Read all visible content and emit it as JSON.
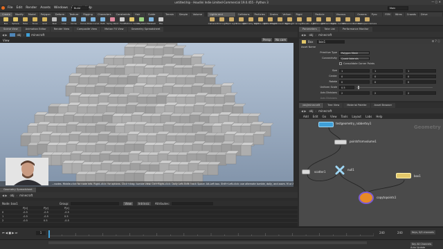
{
  "window": {
    "title": "untitled.hip - Houdini Indie Limited-Commercial 19.0.455 - Python 3"
  },
  "menubar": {
    "items": [
      "File",
      "Edit",
      "Render",
      "Assets",
      "Windows",
      "Arnold",
      "Help"
    ],
    "desktop": "Build",
    "user": "Main"
  },
  "shelf_tabs_left": [
    "Create",
    "Modify",
    "Model",
    "Polygon",
    "Deform",
    "Texture",
    "Rigging",
    "Characters",
    "Constraints",
    "Hair Utils",
    "Guide Process",
    "Terrain FX",
    "Simple FX",
    "Volume"
  ],
  "shelf_tabs_right": [
    "Lights and Cameras",
    "Collisions",
    "Particles",
    "Grains",
    "Vellum",
    "Rigid Bodies",
    "Particle Fluids",
    "Viscous Fluids",
    "Oceans",
    "Pyro FX",
    "FEM",
    "Wires",
    "Crowds",
    "Drive Simulation"
  ],
  "shelf_tools_left": [
    "Box",
    "Sphere",
    "Tube",
    "Torus",
    "Grid",
    "Null",
    "Line",
    "Circle",
    "Curve",
    "Draw Curve",
    "Path",
    "Spray Paint",
    "Font",
    "Platonic Solids",
    "L-System",
    "Metaball",
    "File"
  ],
  "shelf_tools_right": [
    "Camera",
    "Point Light",
    "Spot Light",
    "Area Light",
    "Geometry Light",
    "Volume Light",
    "Distant Light",
    "Environment Light",
    "Sky Light",
    "GI Light",
    "Caustic Light",
    "Portal Light",
    "Ambient Light",
    "Stereo Camera",
    "VR Camera",
    "Switcher",
    "Gamepad Camera"
  ],
  "left_pane_tabs": [
    "Scene View",
    "Animation Editor",
    "Render View",
    "Composite View",
    "Motion FX View",
    "Geometry Spreadsheet"
  ],
  "left_path": {
    "context": "obj",
    "node": "minecraft"
  },
  "view_header": {
    "label": "View",
    "persp": "Persp",
    "cam": "No cam"
  },
  "viewport_status": "...nodes. Middle-click for node info. Right-click: for options.  Click+drag: tumble view. Ctrl+Right-click: Dolly Left-Shift: track Space: Alt-Left box.  Shift+Left-click: use alternate tumble, dolly, and zoom.     M or Alt-M for First Person Navigation.",
  "lower_pane_tabs": [
    "Geometry Spreadsheet"
  ],
  "lower_path": {
    "context": "obj",
    "node": "minecraft"
  },
  "spreadsheet": {
    "node_label": "Node: box1",
    "group_label": "Group:",
    "view_label": "View",
    "intrinsic_label": "Intrinsic",
    "attributes_label": "Attributes:",
    "columns": [
      "",
      "P[x]",
      "P[y]",
      "P[z]"
    ],
    "rows": [
      [
        "0",
        "-0.5",
        "-0.5",
        "-0.5"
      ],
      [
        "1",
        "-0.5",
        "-0.5",
        "0.5"
      ],
      [
        "2",
        "-0.5",
        "0.5",
        "-0.5"
      ]
    ]
  },
  "timeline": {
    "start": "1",
    "end": "240",
    "current": "1",
    "range_start": "240",
    "range_end": "240",
    "key_all": "Keys, 0/0 channels",
    "key_none": "Key All Channels",
    "auto_update": "Auto Update"
  },
  "right_pane_tabs": [
    "Parameters",
    "Take List",
    "Performance Monitor"
  ],
  "param_path": {
    "context": "obj",
    "node": "minecraft"
  },
  "param_node": {
    "type": "Box",
    "name": "box1"
  },
  "params": {
    "asset_name_label": "Asset Name",
    "primitive_type_label": "Primitive Type",
    "primitive_type": "Polygon Mesh",
    "connectivity_label": "Connectivity",
    "connectivity": "Quadrilaterals",
    "consolidate_label": "Consolidate Corner Points",
    "size_label": "Size",
    "size": [
      "1",
      "1",
      "1"
    ],
    "center_label": "Center",
    "center": [
      "0",
      "0",
      "0"
    ],
    "rotate_label": "Rotate",
    "rotate": [
      "0",
      "0",
      "0"
    ],
    "uniform_scale_label": "Uniform Scale",
    "uniform_scale": "0.5",
    "axis_divisions_label": "Axis Divisions",
    "axis_divisions": [
      "2",
      "2",
      "2"
    ],
    "axis_divs_extra": "Axis Divisions"
  },
  "net_tabs": [
    "/obj/minecraft",
    "Tree View",
    "Material Palette",
    "Asset Browser"
  ],
  "net_path": {
    "context": "obj",
    "node": "minecraft"
  },
  "net_toolbar": [
    "Add",
    "Edit",
    "Go",
    "View",
    "Tools",
    "Layout",
    "Labs",
    "Help"
  ],
  "net_context_label": "Geometry",
  "nodes": {
    "testgeometry": "testgeometry_rubbertoy1",
    "pointsfromvolume": "pointsfromvolume1",
    "scatter": "scatter1",
    "null": "null1",
    "box": "box1",
    "copytopoints": "copytopoints1"
  },
  "colors": {
    "accent_blue": "#3fa0d8",
    "node_yellow": "#e3c86a",
    "node_orange": "#e78a26",
    "net_bg": "#4a4a4a"
  }
}
